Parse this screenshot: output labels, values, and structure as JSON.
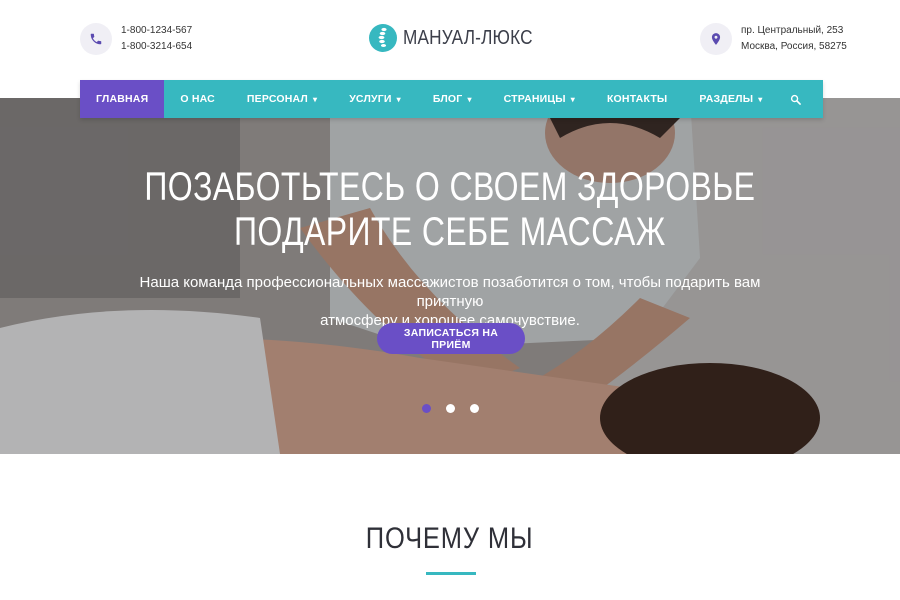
{
  "header": {
    "phones": [
      "1-800-1234-567",
      "1-800-3214-654"
    ],
    "logo_text": "МАНУАЛ-ЛЮКС",
    "address": [
      "пр. Центральный, 253",
      "Москва, Россия, 58275"
    ],
    "icons": {
      "phone": "phone-icon",
      "location": "location-pin-icon",
      "logo": "spine-logo-icon"
    }
  },
  "nav": {
    "items": [
      {
        "label": "ГЛАВНАЯ",
        "active": true
      },
      {
        "label": "О НАС"
      },
      {
        "label": "ПЕРСОНАЛ",
        "dropdown": true
      },
      {
        "label": "УСЛУГИ",
        "dropdown": true
      },
      {
        "label": "БЛОГ",
        "dropdown": true
      },
      {
        "label": "СТРАНИЦЫ",
        "dropdown": true
      },
      {
        "label": "КОНТАКТЫ"
      },
      {
        "label": "РАЗДЕЛЫ",
        "dropdown": true
      }
    ],
    "search_icon": "search-icon"
  },
  "hero": {
    "title_line1": "ПОЗАБОТЬТЕСЬ О СВОЕМ ЗДОРОВЬЕ",
    "title_line2": "ПОДАРИТЕ СЕБЕ МАССАЖ",
    "subtitle_line1": "Наша команда профессиональных массажистов позаботится о том, чтобы подарить вам приятную",
    "subtitle_line2": "атмосферу и хорошее самочувствие.",
    "cta_label": "ЗАПИСАТЬСЯ НА ПРИЁМ",
    "slides_count": 3,
    "active_slide": 1
  },
  "section": {
    "title": "ПОЧЕМУ МЫ"
  },
  "colors": {
    "accent": "#37b8c0",
    "primary": "#6a4fc6",
    "text": "#333333"
  }
}
